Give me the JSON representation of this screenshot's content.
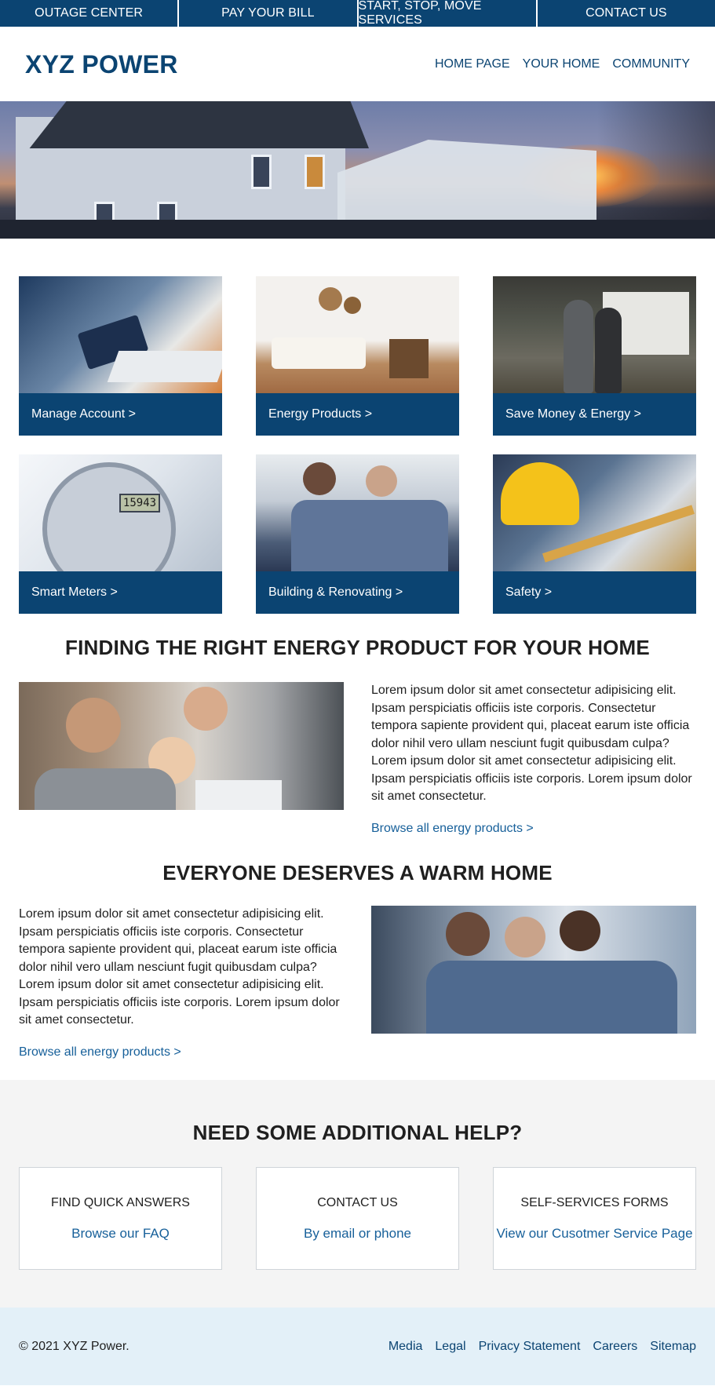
{
  "top_nav": [
    "OUTAGE CENTER",
    "PAY YOUR BILL",
    "START, STOP, MOVE SERVICES",
    "CONTACT US"
  ],
  "header": {
    "logo": "XYZ POWER",
    "nav": [
      "HOME PAGE",
      "YOUR HOME",
      "COMMUNITY"
    ]
  },
  "tiles": [
    {
      "label": "Manage Account >"
    },
    {
      "label": "Energy Products >"
    },
    {
      "label": "Save Money & Energy >"
    },
    {
      "label": "Smart Meters >"
    },
    {
      "label": "Building & Renovating >"
    },
    {
      "label": "Safety >"
    }
  ],
  "section1": {
    "title": "FINDING THE RIGHT ENERGY PRODUCT FOR YOUR HOME",
    "body": "Lorem ipsum dolor sit amet consectetur adipisicing elit. Ipsam perspiciatis officiis iste corporis. Consectetur tempora sapiente provident qui, placeat earum iste officia dolor nihil vero ullam nesciunt fugit quibusdam culpa? Lorem ipsum dolor sit amet consectetur adipisicing elit. Ipsam perspiciatis officiis iste corporis. Lorem ipsum dolor sit amet consectetur.",
    "link": "Browse all energy products >"
  },
  "section2": {
    "title": "EVERYONE DESERVES A WARM HOME",
    "body": "Lorem ipsum dolor sit amet consectetur adipisicing elit. Ipsam perspiciatis officiis iste corporis. Consectetur tempora sapiente provident qui, placeat earum iste officia dolor nihil vero ullam nesciunt fugit quibusdam culpa? Lorem ipsum dolor sit amet consectetur adipisicing elit. Ipsam perspiciatis officiis iste corporis. Lorem ipsum dolor sit amet consectetur.",
    "link": "Browse all energy products >"
  },
  "help": {
    "title": "NEED SOME ADDITIONAL HELP?",
    "cards": [
      {
        "heading": "FIND QUICK ANSWERS",
        "link": "Browse our FAQ"
      },
      {
        "heading": "CONTACT US",
        "link": "By email or phone"
      },
      {
        "heading": "SELF-SERVICES FORMS",
        "link": "View our Cusotmer Service Page"
      }
    ]
  },
  "footer": {
    "copyright": "© 2021 XYZ Power.",
    "links": [
      "Media",
      "Legal",
      "Privacy Statement",
      "Careers",
      "Sitemap"
    ]
  },
  "meter_display": "15943",
  "colors": {
    "brand_navy": "#0b4472",
    "link_blue": "#17609a",
    "help_bg": "#f4f4f4",
    "footer_bg": "#e3f0f8"
  }
}
